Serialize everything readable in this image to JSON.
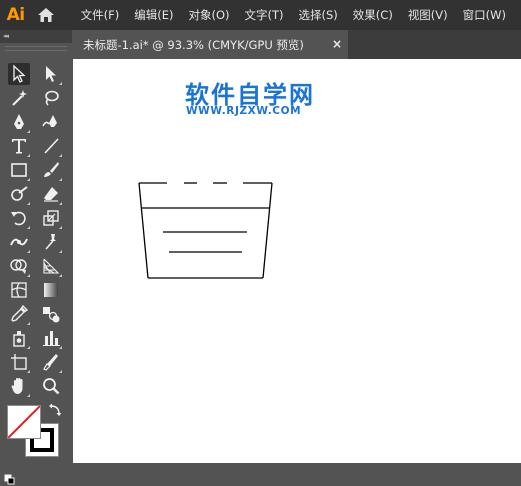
{
  "app": {
    "logo_text": "Ai",
    "brand_color": "#FF9A00"
  },
  "menu": [
    {
      "label": "文件(F)"
    },
    {
      "label": "编辑(E)"
    },
    {
      "label": "对象(O)"
    },
    {
      "label": "文字(T)"
    },
    {
      "label": "选择(S)"
    },
    {
      "label": "效果(C)"
    },
    {
      "label": "视图(V)"
    },
    {
      "label": "窗口(W)"
    }
  ],
  "tools_panel": {
    "collapse_glyph": "◂◂",
    "tools": [
      {
        "name": "selection-tool-icon",
        "active": true
      },
      {
        "name": "direct-selection-tool-icon"
      },
      {
        "name": "magic-wand-tool-icon"
      },
      {
        "name": "lasso-tool-icon"
      },
      {
        "name": "pen-tool-icon"
      },
      {
        "name": "curvature-tool-icon"
      },
      {
        "name": "type-tool-icon"
      },
      {
        "name": "line-segment-tool-icon"
      },
      {
        "name": "rectangle-tool-icon"
      },
      {
        "name": "paintbrush-tool-icon"
      },
      {
        "name": "shaper-tool-icon"
      },
      {
        "name": "eraser-tool-icon"
      },
      {
        "name": "rotate-tool-icon"
      },
      {
        "name": "scale-tool-icon"
      },
      {
        "name": "width-tool-icon"
      },
      {
        "name": "puppet-warp-tool-icon"
      },
      {
        "name": "shape-builder-tool-icon"
      },
      {
        "name": "perspective-grid-tool-icon"
      },
      {
        "name": "mesh-tool-icon"
      },
      {
        "name": "gradient-tool-icon"
      },
      {
        "name": "eyedropper-tool-icon"
      },
      {
        "name": "blend-tool-icon"
      },
      {
        "name": "symbol-sprayer-tool-icon"
      },
      {
        "name": "column-graph-tool-icon"
      },
      {
        "name": "artboard-tool-icon"
      },
      {
        "name": "slice-tool-icon"
      },
      {
        "name": "hand-tool-icon"
      },
      {
        "name": "zoom-tool-icon"
      }
    ],
    "fill_color": "#FFFFFF",
    "fill_state": "none",
    "stroke_color": "#000000"
  },
  "document_tab": {
    "title": "未标题-1.ai* @ 93.3% (CMYK/GPU 预览)",
    "close_glyph": "×"
  },
  "canvas": {
    "watermark_title": "软件自学网",
    "watermark_url": "WWW.RJZXW.COM",
    "watermark_color": "#1A73D6"
  }
}
